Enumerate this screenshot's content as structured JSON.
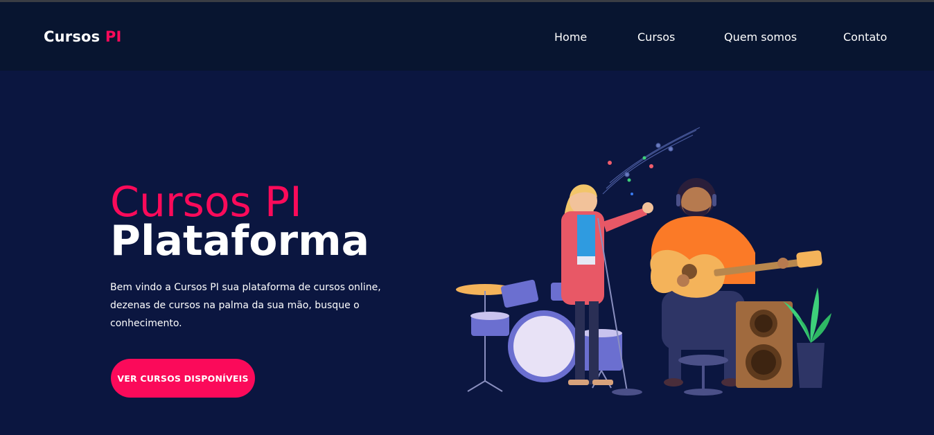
{
  "brand": {
    "name": "Cursos",
    "accent": "PI"
  },
  "nav": {
    "items": [
      {
        "label": "Home"
      },
      {
        "label": "Cursos"
      },
      {
        "label": "Quem somos"
      },
      {
        "label": "Contato"
      }
    ]
  },
  "hero": {
    "title_line1": "Cursos PI",
    "title_line2": "Plataforma",
    "description_lines": [
      "Bem vindo a Cursos PI sua plataforma de cursos online,",
      "dezenas de cursos na palma da sua mão, busque o",
      "conhecimento."
    ],
    "cta_label": "VER CURSOS DISPONÍVEIS"
  },
  "colors": {
    "accent": "#fb0a5a",
    "navbar_bg": "#081530",
    "hero_bg": "#0b1640",
    "text": "#ffffff"
  },
  "illustration": {
    "icon": "music-band-illustration"
  }
}
